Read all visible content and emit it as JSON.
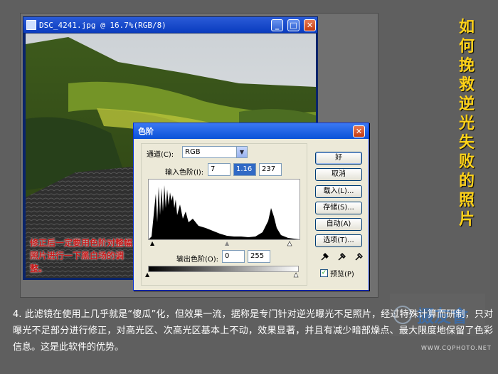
{
  "image_window": {
    "title": "DSC_4241.jpg @ 16.7%(RGB/8)",
    "buttons": {
      "minimize": "_",
      "maximize": "□",
      "close": "✕"
    }
  },
  "levels_dialog": {
    "title": "色阶",
    "channel_label": "通道(C):",
    "channel_value": "RGB",
    "input_levels_label": "输入色阶(I):",
    "input_black": "7",
    "input_gamma": "1.16",
    "input_white": "237",
    "output_levels_label": "输出色阶(O):",
    "output_black": "0",
    "output_white": "255",
    "buttons": {
      "ok": "好",
      "cancel": "取消",
      "load": "载入(L)...",
      "save": "存储(S)...",
      "auto": "自动(A)",
      "options": "选项(T)..."
    },
    "preview_label": "预览(P)",
    "preview_checked": true
  },
  "annotation_red": "修正后一定要用色阶对整幅照片进行一下黑白场的调整。",
  "vertical_title": [
    "如",
    "何",
    "挽",
    "救",
    "逆",
    "光",
    "失",
    "败",
    "的",
    "照",
    "片"
  ],
  "description": "4. 此滤镜在使用上几乎就是“傻瓜”化，但效果一流，据称是专门针对逆光曝光不足照片，经过特殊计算而研制，只对曝光不足部分进行修正，对高光区、次高光区基本上不动，效果显著，并且有减少暗部燥点、最大限度地保留了色彩信息。这是此软件的优势。",
  "watermark": {
    "text": "摄友會",
    "url": "WWW.CQPHOTO.NET"
  },
  "colors": {
    "accent_title": "#ffd21a",
    "annotation": "#c81a1a",
    "xp_blue": "#0a52d8"
  }
}
